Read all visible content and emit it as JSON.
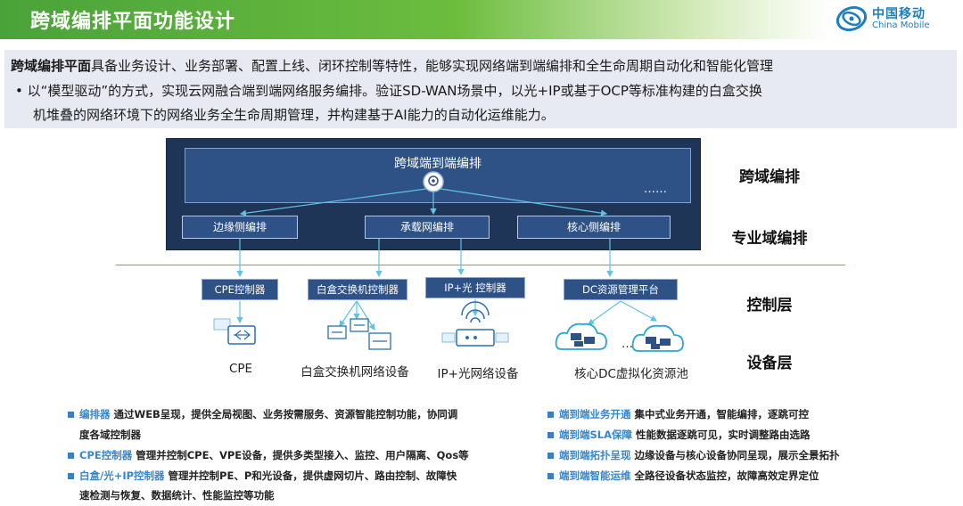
{
  "header": {
    "title": "跨域编排平面功能设计"
  },
  "logo": {
    "cn": "中国移动",
    "en": "China Mobile"
  },
  "intro": {
    "line1_strong": "跨域编排平面",
    "line1_rest": "具备业务设计、业务部署、配置上线、闭环控制等特性，能够实现网络端到端编排和全生命周期自动化和智能化管理",
    "bullet_line1": "•  以“模型驱动”的方式，实现云网融合端到端网络服务编排。验证SD-WAN场景中，以光+IP或基于OCP等标准构建的白盒交换",
    "bullet_line2": "机堆叠的网络环境下的网络业务全生命周期管理，并构建基于AI能力的自动化运维能力。"
  },
  "diagram": {
    "orchestrator": "跨域端到端编排",
    "ellipsis": "……",
    "sub_orchestrators": [
      "边缘侧编排",
      "承载网编排",
      "核心侧编排"
    ],
    "controllers": [
      "CPE控制器",
      "白盒交换机控制器",
      "IP+光 控制器",
      "DC资源管理平台"
    ],
    "devices": [
      "CPE",
      "白盒交换机网络设备",
      "IP+光网络设备",
      "核心DC虚拟化资源池"
    ],
    "cloud_ellipsis": "……",
    "layers": [
      "跨域编排",
      "专业域编排",
      "控制层",
      "设备层"
    ]
  },
  "bullets_left": [
    {
      "key": "编排器",
      "text": " 通过WEB呈现，提供全局视图、业务按需服务、资源智能控制功能，协同调"
    },
    {
      "key": "",
      "text": "度各域控制器"
    },
    {
      "key": "CPE控制器",
      "text": " 管理并控制CPE、VPE设备，提供多类型接入、监控、用户隔离、Qos等"
    },
    {
      "key": "白盒/光+IP控制器",
      "text": " 管理并控制PE、P和光设备，提供虚网切片、路由控制、故障快"
    },
    {
      "key": "",
      "text": "速检测与恢复、数据统计、性能监控等功能"
    }
  ],
  "bullets_right": [
    {
      "key": "端到端业务开通",
      "text": "  集中式业务开通，智能编排，逐跳可控"
    },
    {
      "key": "端到端SLA保障",
      "text": "  性能数据逐跳可见，实时调整路由选路"
    },
    {
      "key": "端到端拓扑呈现",
      "text": "  边缘设备与核心设备协同呈现，展示全景拓扑"
    },
    {
      "key": "端到端智能运维",
      "text": "  全路径设备状态监控，故障高效定界定位"
    }
  ]
}
